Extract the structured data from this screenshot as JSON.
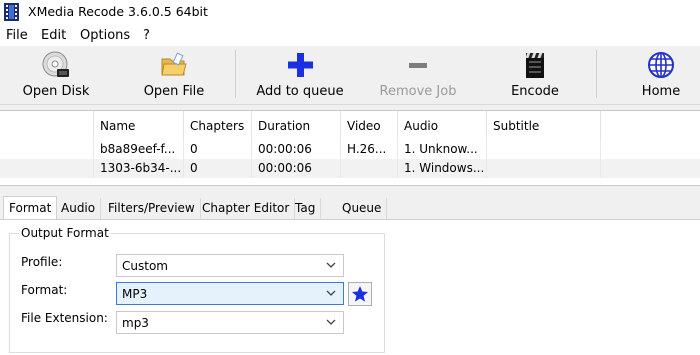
{
  "window": {
    "title": "XMedia Recode 3.6.0.5 64bit"
  },
  "menu": [
    "File",
    "Edit",
    "Options",
    "?"
  ],
  "toolbar": {
    "open_disk": "Open Disk",
    "open_file": "Open File",
    "add_to_queue": "Add to queue",
    "remove_job": "Remove Job",
    "encode": "Encode",
    "home": "Home"
  },
  "filelist": {
    "columns": [
      "Name",
      "Chapters",
      "Duration",
      "Video",
      "Audio",
      "Subtitle"
    ],
    "rows": [
      {
        "name": "b8a89eef-f...",
        "chapters": "0",
        "duration": "00:00:06",
        "video": "H.26...",
        "audio": "1. Unknow...",
        "subtitle": ""
      },
      {
        "name": "1303-6b34-...",
        "chapters": "0",
        "duration": "00:00:06",
        "video": "",
        "audio": "1. Windows...",
        "subtitle": ""
      }
    ]
  },
  "tabs": [
    "Format",
    "Audio",
    "Filters/Preview",
    "Chapter Editor",
    "Tag",
    "Queue"
  ],
  "output_format": {
    "group_title": "Output Format",
    "profile_label": "Profile:",
    "profile_value": "Custom",
    "format_label": "Format:",
    "format_value": "MP3",
    "extension_label": "File Extension:",
    "extension_value": "mp3"
  },
  "colors": {
    "accent_blue": "#1a2fe0",
    "selection": "#e5f1fb"
  },
  "icons": {
    "open_disk": "disc-icon",
    "open_file": "folder-icon",
    "add_to_queue": "plus-icon",
    "remove_job": "minus-icon",
    "encode": "clapperboard-icon",
    "home": "globe-icon",
    "favorite": "star-icon"
  }
}
